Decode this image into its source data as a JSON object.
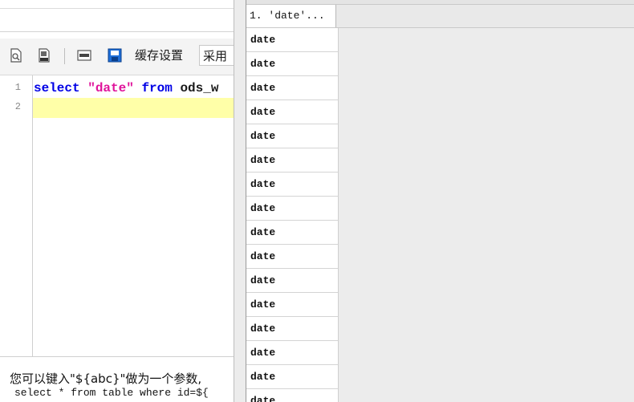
{
  "toolbar": {
    "cache_settings_label": "缓存设置",
    "mode_select_value": "采用"
  },
  "editor": {
    "line_numbers": [
      "1",
      "2"
    ],
    "line_1": {
      "kw_select": "select",
      "string_date": "\"date\"",
      "kw_from": "from",
      "table_name": "ods_w"
    }
  },
  "hint": {
    "line_1": "您可以键入\"${abc}\"做为一个参数,",
    "line_2": "select * from table where id=${"
  },
  "result_grid": {
    "column_header": "1. 'date'...",
    "rows": [
      "date",
      "date",
      "date",
      "date",
      "date",
      "date",
      "date",
      "date",
      "date",
      "date",
      "date",
      "date",
      "date",
      "date",
      "date",
      "date"
    ]
  },
  "colors": {
    "keyword": "#0000e6",
    "string": "#e0149b",
    "current_line_highlight": "#ffffa8"
  }
}
